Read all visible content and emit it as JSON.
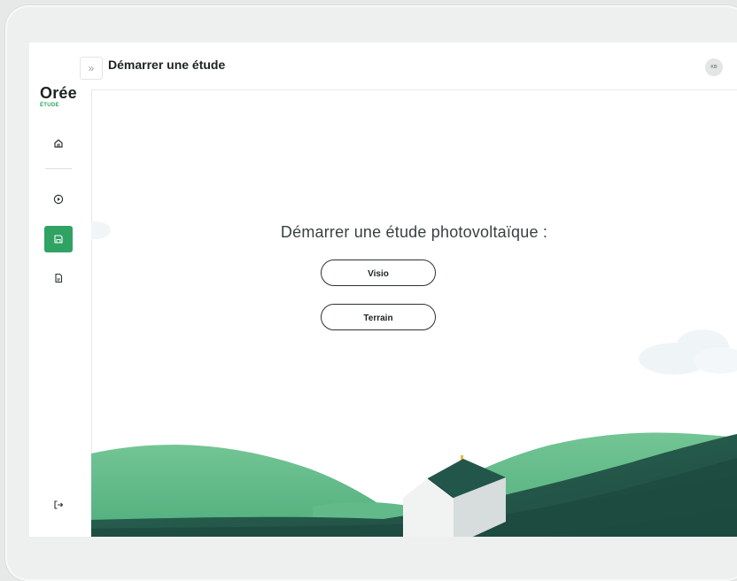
{
  "app": {
    "logo_name": "Orée",
    "logo_sub": "ÉTUDE"
  },
  "header": {
    "title": "Démarrer une étude",
    "avatar_initials": "KB",
    "collapse_glyph": "»"
  },
  "sidebar": {
    "items": [
      {
        "icon": "home-icon",
        "active": false
      },
      {
        "icon": "play-circle-icon",
        "active": false
      },
      {
        "icon": "save-icon",
        "active": true
      },
      {
        "icon": "document-icon",
        "active": false
      }
    ],
    "logout_icon": "logout-icon"
  },
  "main": {
    "prompt": "Démarrer une étude photovoltaïque :",
    "buttons": {
      "visio": "Visio",
      "terrain": "Terrain"
    }
  },
  "colors": {
    "accent": "#2fa264",
    "hill_light": "#6cc08f",
    "hill_dark": "#245547",
    "roof": "#23564a"
  }
}
